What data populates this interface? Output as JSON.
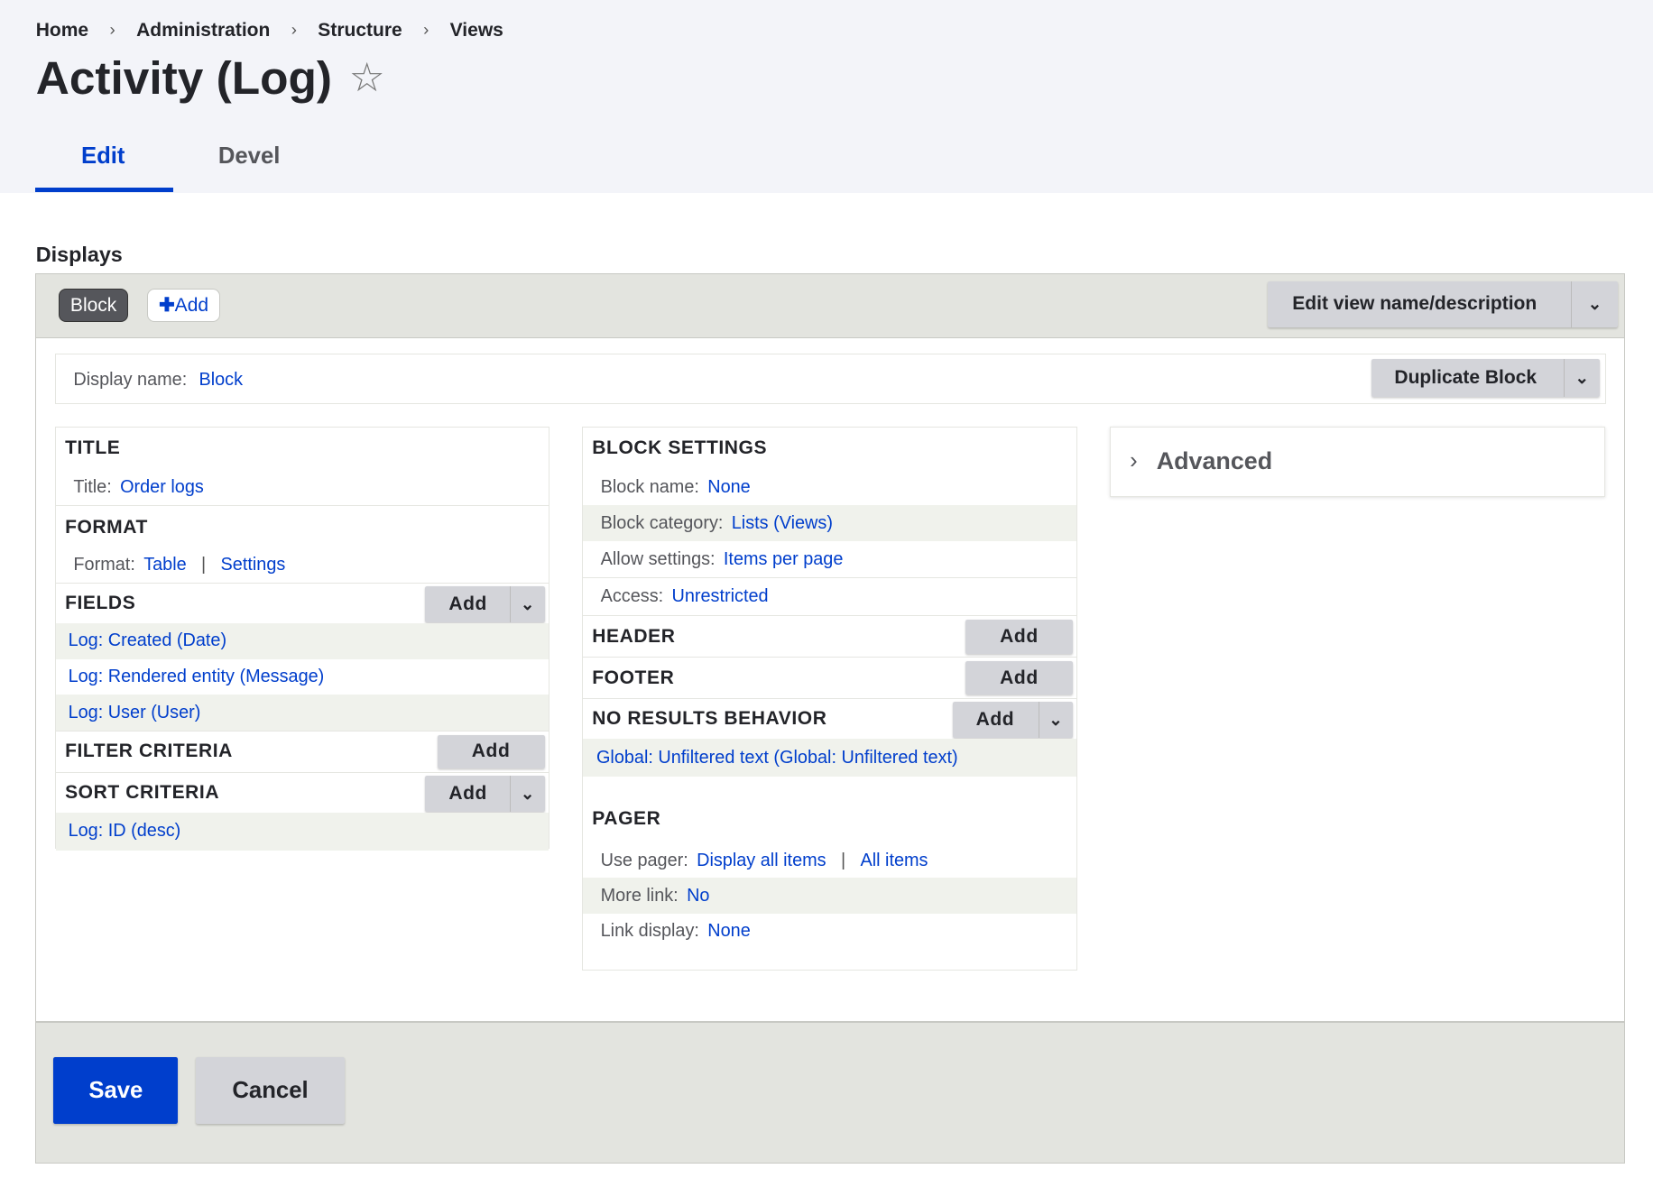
{
  "breadcrumb": [
    "Home",
    "Administration",
    "Structure",
    "Views"
  ],
  "page_title": "Activity (Log)",
  "tabs": [
    "Edit",
    "Devel"
  ],
  "displays_heading": "Displays",
  "display_tabs": {
    "block": "Block",
    "add": "Add"
  },
  "edit_view_label": "Edit view name/description",
  "display_name": {
    "label": "Display name:",
    "value": "Block"
  },
  "duplicate_label": "Duplicate Block",
  "left": {
    "title_h": "TITLE",
    "title_label": "Title:",
    "title_value": "Order logs",
    "format_h": "FORMAT",
    "format_label": "Format:",
    "format_value": "Table",
    "format_settings": "Settings",
    "fields_h": "FIELDS",
    "fields": [
      "Log: Created (Date)",
      "Log: Rendered entity (Message)",
      "Log: User (User)"
    ],
    "filter_h": "FILTER CRITERIA",
    "sort_h": "SORT CRITERIA",
    "sorts": [
      "Log: ID (desc)"
    ],
    "add": "Add"
  },
  "middle": {
    "block_h": "BLOCK SETTINGS",
    "rows": [
      {
        "label": "Block name:",
        "value": "None"
      },
      {
        "label": "Block category:",
        "value": "Lists (Views)"
      },
      {
        "label": "Allow settings:",
        "value": "Items per page"
      },
      {
        "label": "Access:",
        "value": "Unrestricted"
      }
    ],
    "header_h": "HEADER",
    "footer_h": "FOOTER",
    "noresults_h": "NO RESULTS BEHAVIOR",
    "noresults_item": "Global: Unfiltered text (Global: Unfiltered text)",
    "pager_h": "PAGER",
    "pager_label": "Use pager:",
    "pager_value": "Display all items",
    "pager_value2": "All items",
    "more_label": "More link:",
    "more_value": "No",
    "link_label": "Link display:",
    "link_value": "None",
    "add": "Add"
  },
  "advanced": "Advanced",
  "save": "Save",
  "cancel": "Cancel"
}
